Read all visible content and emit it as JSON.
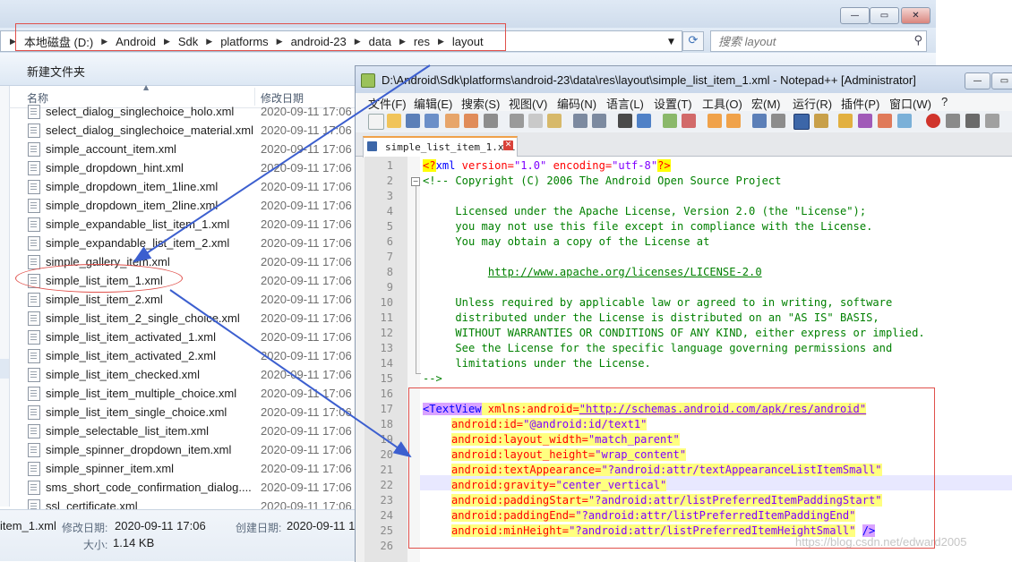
{
  "explorer": {
    "window_buttons": [
      "—",
      "▭",
      "✕"
    ],
    "breadcrumbs": [
      "本地磁盘 (D:)",
      "Android",
      "Sdk",
      "platforms",
      "android-23",
      "data",
      "res",
      "layout"
    ],
    "search_placeholder": "搜索 layout",
    "toolbar": {
      "new_folder": "新建文件夹"
    },
    "columns": {
      "name": "名称",
      "date": "修改日期"
    },
    "files": [
      {
        "name": "select_dialog_singlechoice_holo.xml",
        "date": "2020-09-11 17:06"
      },
      {
        "name": "select_dialog_singlechoice_material.xml",
        "date": "2020-09-11 17:06"
      },
      {
        "name": "simple_account_item.xml",
        "date": "2020-09-11 17:06"
      },
      {
        "name": "simple_dropdown_hint.xml",
        "date": "2020-09-11 17:06"
      },
      {
        "name": "simple_dropdown_item_1line.xml",
        "date": "2020-09-11 17:06"
      },
      {
        "name": "simple_dropdown_item_2line.xml",
        "date": "2020-09-11 17:06"
      },
      {
        "name": "simple_expandable_list_item_1.xml",
        "date": "2020-09-11 17:06"
      },
      {
        "name": "simple_expandable_list_item_2.xml",
        "date": "2020-09-11 17:06"
      },
      {
        "name": "simple_gallery_item.xml",
        "date": "2020-09-11 17:06"
      },
      {
        "name": "simple_list_item_1.xml",
        "date": "2020-09-11 17:06"
      },
      {
        "name": "simple_list_item_2.xml",
        "date": "2020-09-11 17:06"
      },
      {
        "name": "simple_list_item_2_single_choice.xml",
        "date": "2020-09-11 17:06"
      },
      {
        "name": "simple_list_item_activated_1.xml",
        "date": "2020-09-11 17:06"
      },
      {
        "name": "simple_list_item_activated_2.xml",
        "date": "2020-09-11 17:06"
      },
      {
        "name": "simple_list_item_checked.xml",
        "date": "2020-09-11 17:06"
      },
      {
        "name": "simple_list_item_multiple_choice.xml",
        "date": "2020-09-11 17:06"
      },
      {
        "name": "simple_list_item_single_choice.xml",
        "date": "2020-09-11 17:06"
      },
      {
        "name": "simple_selectable_list_item.xml",
        "date": "2020-09-11 17:06"
      },
      {
        "name": "simple_spinner_dropdown_item.xml",
        "date": "2020-09-11 17:06"
      },
      {
        "name": "simple_spinner_item.xml",
        "date": "2020-09-11 17:06"
      },
      {
        "name": "sms_short_code_confirmation_dialog....",
        "date": "2020-09-11 17:06"
      },
      {
        "name": "ssl_certificate.xml",
        "date": "2020-09-11 17:06"
      }
    ],
    "details": {
      "name": "item_1.xml",
      "modified_label": "修改日期:",
      "modified_value": "2020-09-11 17:06",
      "created_label": "创建日期:",
      "created_value": "2020-09-11 17",
      "size_label": "大小:",
      "size_value": "1.14 KB"
    }
  },
  "notepad": {
    "title": "D:\\Android\\Sdk\\platforms\\android-23\\data\\res\\layout\\simple_list_item_1.xml - Notepad++ [Administrator]",
    "window_buttons": [
      "—",
      "▭",
      "✕"
    ],
    "menu": [
      "文件(F)",
      "编辑(E)",
      "搜索(S)",
      "视图(V)",
      "编码(N)",
      "语言(L)",
      "设置(T)",
      "工具(O)",
      "宏(M)",
      "运行(R)",
      "插件(P)",
      "窗口(W)",
      "?"
    ],
    "tab_label": "simple_list_item_1.xml",
    "line_numbers": [
      "1",
      "2",
      "3",
      "4",
      "5",
      "6",
      "7",
      "8",
      "9",
      "10",
      "11",
      "12",
      "13",
      "14",
      "15",
      "16",
      "17",
      "18",
      "19",
      "20",
      "21",
      "22",
      "23",
      "24",
      "25",
      "26"
    ],
    "code": {
      "l1_pi_open": "<?",
      "l1_xml": "xml",
      "l1_version_attr": " version=",
      "l1_version_val": "\"1.0\"",
      "l1_enc_attr": " encoding=",
      "l1_enc_val": "\"utf-8\"",
      "l1_pi_close": "?>",
      "l2": "<!-- Copyright (C) 2006 The Android Open Source Project",
      "l3": "",
      "l4": "     Licensed under the Apache License, Version 2.0 (the \"License\");",
      "l5": "     you may not use this file except in compliance with the License.",
      "l6": "     You may obtain a copy of the License at",
      "l7": "",
      "l8_indent": "          ",
      "l8_url": "http://www.apache.org/licenses/LICENSE-2.0",
      "l9": "",
      "l10": "     Unless required by applicable law or agreed to in writing, software",
      "l11": "     distributed under the License is distributed on an \"AS IS\" BASIS,",
      "l12": "     WITHOUT WARRANTIES OR CONDITIONS OF ANY KIND, either express or implied.",
      "l13": "     See the License for the specific language governing permissions and",
      "l14": "     limitations under the License.",
      "l15": "-->",
      "l17_tag": "<TextView",
      "l17_attr": " xmlns:android=",
      "l17_val": "\"http://schemas.android.com/apk/res/android\"",
      "l18_attr": "android:id=",
      "l18_val": "\"@android:id/text1\"",
      "l19_attr": "android:layout_width=",
      "l19_val": "\"match_parent\"",
      "l20_attr": "android:layout_height=",
      "l20_val": "\"wrap_content\"",
      "l21_attr": "android:textAppearance=",
      "l21_val": "\"?android:attr/textAppearanceListItemSmall\"",
      "l22_attr": "android:gravity=",
      "l22_val": "\"center_vertical\"",
      "l23_attr": "android:paddingStart=",
      "l23_val": "\"?android:attr/listPreferredItemPaddingStart\"",
      "l24_attr": "android:paddingEnd=",
      "l24_val": "\"?android:attr/listPreferredItemPaddingEnd\"",
      "l25_attr": "android:minHeight=",
      "l25_val": "\"?android:attr/listPreferredItemHeightSmall\"",
      "l25_close": "/>"
    }
  },
  "watermark": "https://blog.csdn.net/edward2005",
  "colors": {
    "annotation_red": "#e0504b",
    "arrow_blue": "#3c5fcf"
  }
}
